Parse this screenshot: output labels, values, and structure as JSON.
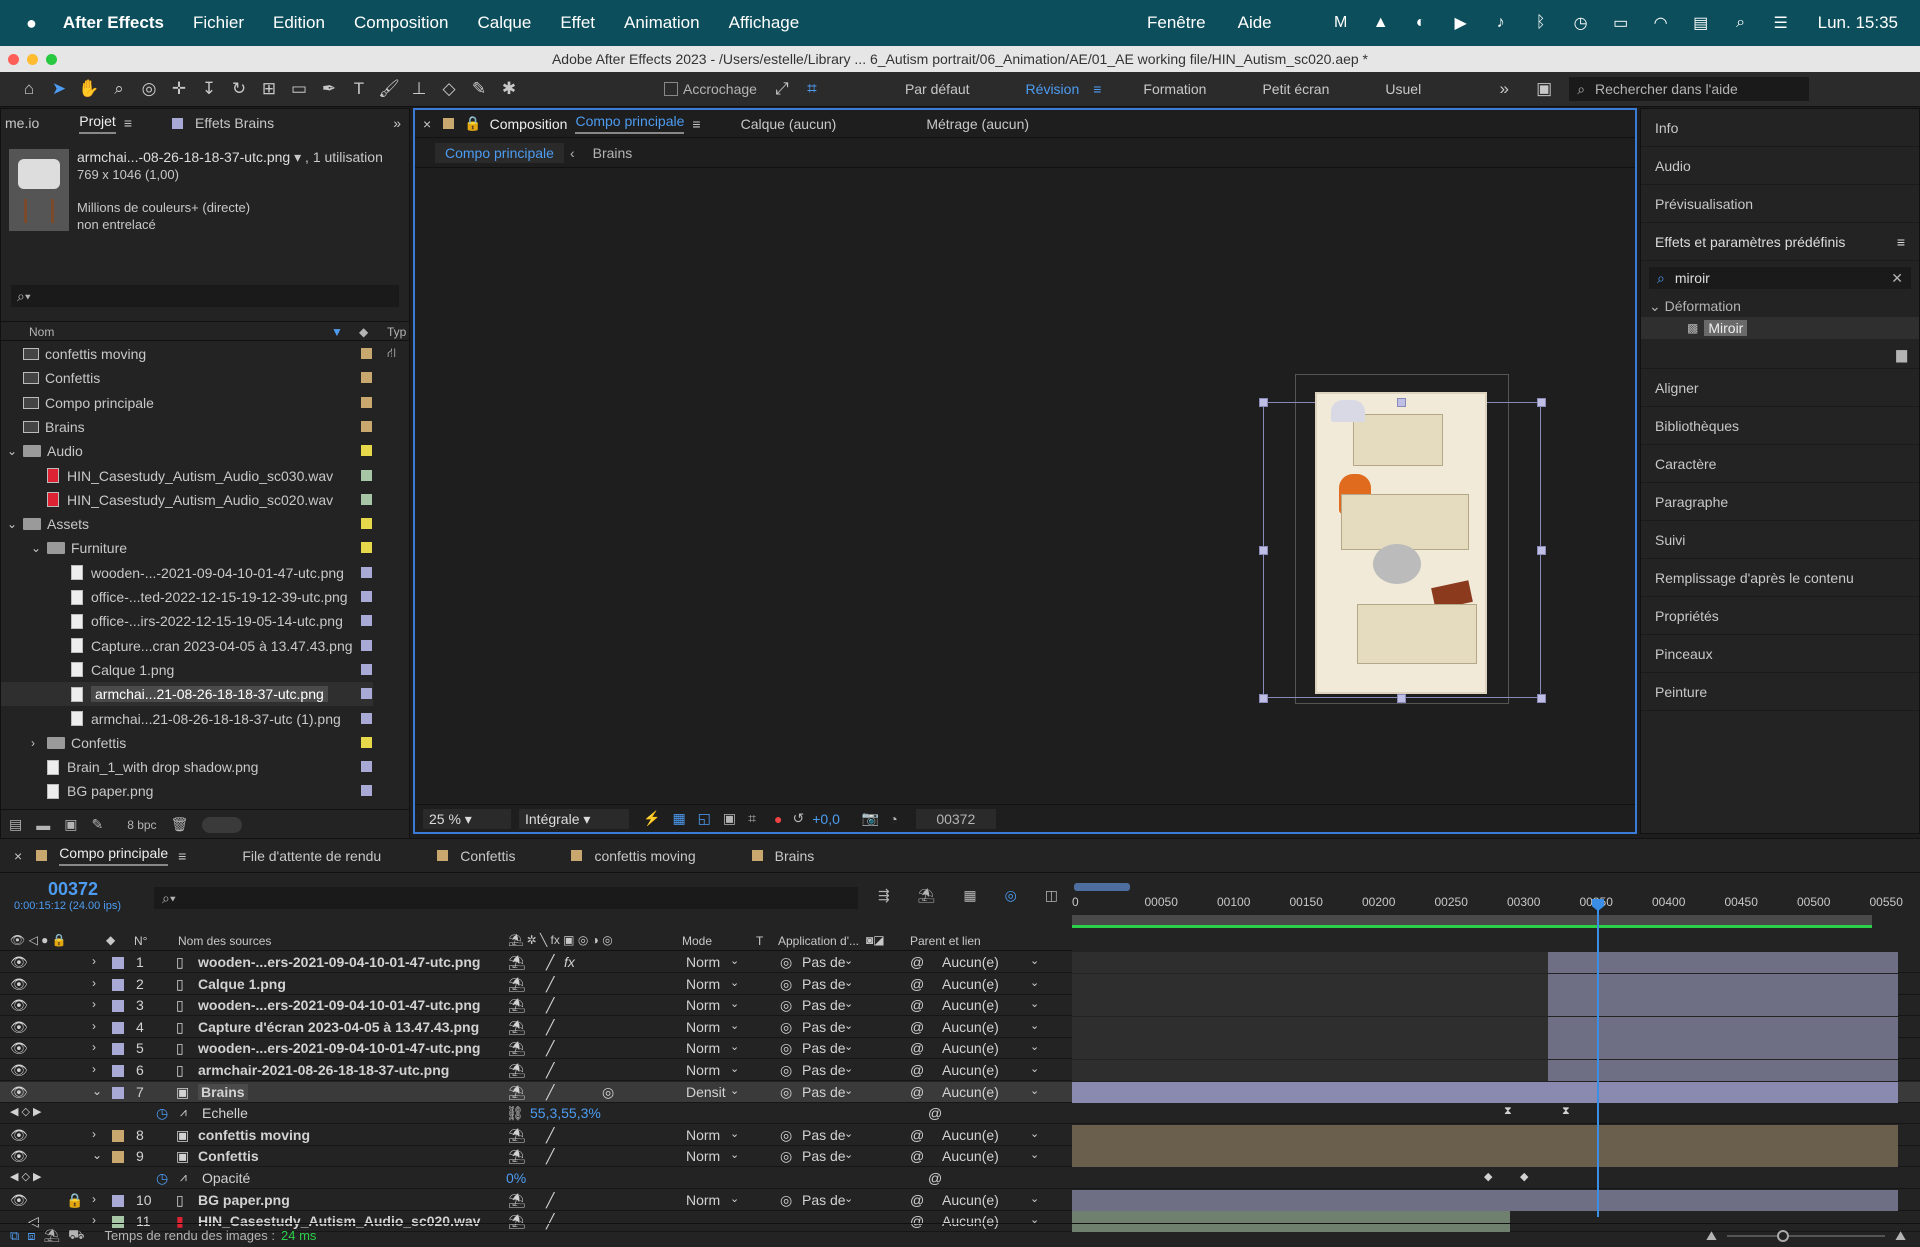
{
  "menubar": {
    "app_name": "After Effects",
    "items": [
      "Fichier",
      "Edition",
      "Composition",
      "Calque",
      "Effet",
      "Animation",
      "Affichage"
    ],
    "right_items": [
      "Fenêtre",
      "Aide"
    ],
    "clock": "Lun. 15:35"
  },
  "window": {
    "title": "Adobe After Effects 2023 - /Users/estelle/Library ... 6_Autism portrait/06_Animation/AE/01_AE working file/HIN_Autism_sc020.aep *"
  },
  "toolbar": {
    "snapping_label": "Accrochage",
    "workspaces": [
      "Par défaut",
      "Révision",
      "Formation",
      "Petit écran",
      "Usuel"
    ],
    "active_workspace": "Révision",
    "help_search_placeholder": "Rechercher dans l'aide"
  },
  "project_panel": {
    "tabs": [
      "me.io",
      "Projet",
      "Effets Brains"
    ],
    "preview": {
      "name": "armchai...-08-26-18-18-37-utc.png",
      "usage": ", 1 utilisation",
      "dimensions": "769 x 1046 (1,00)",
      "color": "Millions de couleurs+ (directe)",
      "scan": "non entrelacé"
    },
    "col_name": "Nom",
    "col_type": "Typ",
    "items": [
      {
        "name": "confettis moving",
        "kind": "comp",
        "indent": 0,
        "label": "#c9a86f"
      },
      {
        "name": "Confettis",
        "kind": "comp",
        "indent": 0,
        "label": "#c9a86f"
      },
      {
        "name": "Compo principale",
        "kind": "comp",
        "indent": 0,
        "label": "#c9a86f"
      },
      {
        "name": "Brains",
        "kind": "comp",
        "indent": 0,
        "label": "#c9a86f"
      },
      {
        "name": "Audio",
        "kind": "folder",
        "indent": 0,
        "open": true,
        "label": "#e6d84a"
      },
      {
        "name": "HIN_Casestudy_Autism_Audio_sc030.wav",
        "kind": "audio",
        "indent": 1,
        "label": "#a6c6a6"
      },
      {
        "name": "HIN_Casestudy_Autism_Audio_sc020.wav",
        "kind": "audio",
        "indent": 1,
        "label": "#a6c6a6"
      },
      {
        "name": "Assets",
        "kind": "folder",
        "indent": 0,
        "open": true,
        "label": "#e6d84a"
      },
      {
        "name": "Furniture",
        "kind": "folder",
        "indent": 1,
        "open": true,
        "label": "#e6d84a"
      },
      {
        "name": "wooden-...-2021-09-04-10-01-47-utc.png",
        "kind": "file",
        "indent": 2,
        "label": "#a9a9d6"
      },
      {
        "name": "office-...ted-2022-12-15-19-12-39-utc.png",
        "kind": "file",
        "indent": 2,
        "label": "#a9a9d6"
      },
      {
        "name": "office-...irs-2022-12-15-19-05-14-utc.png",
        "kind": "file",
        "indent": 2,
        "label": "#a9a9d6"
      },
      {
        "name": "Capture...cran 2023-04-05 à 13.47.43.png",
        "kind": "file",
        "indent": 2,
        "label": "#a9a9d6"
      },
      {
        "name": "Calque 1.png",
        "kind": "file",
        "indent": 2,
        "label": "#a9a9d6"
      },
      {
        "name": "armchai...21-08-26-18-18-37-utc.png",
        "kind": "file",
        "indent": 2,
        "label": "#a9a9d6",
        "selected": true
      },
      {
        "name": "armchai...21-08-26-18-18-37-utc (1).png",
        "kind": "file",
        "indent": 2,
        "label": "#a9a9d6"
      },
      {
        "name": "Confettis",
        "kind": "folder",
        "indent": 1,
        "open": false,
        "label": "#e6d84a"
      },
      {
        "name": "Brain_1_with drop shadow.png",
        "kind": "file",
        "indent": 1,
        "label": "#a9a9d6"
      },
      {
        "name": "BG paper.png",
        "kind": "file",
        "indent": 1,
        "label": "#a9a9d6"
      }
    ],
    "bpc": "8 bpc"
  },
  "comp_panel": {
    "tab_prefix": "Composition",
    "tab_name": "Compo principale",
    "other_tabs": [
      "Calque (aucun)",
      "Métrage (aucun)"
    ],
    "breadcrumb": [
      "Compo principale",
      "Brains"
    ],
    "zoom": "25 %",
    "resolution": "Intégrale",
    "exposure": "+0,0",
    "timecode": "00372"
  },
  "right_panel": {
    "items_top": [
      "Info",
      "Audio",
      "Prévisualisation"
    ],
    "effects_title": "Effets et paramètres prédéfinis",
    "search_value": "miroir",
    "category": "Déformation",
    "effect": "Miroir",
    "items_bottom": [
      "Aligner",
      "Bibliothèques",
      "Caractère",
      "Paragraphe",
      "Suivi",
      "Remplissage d'après le contenu",
      "Propriétés",
      "Pinceaux",
      "Peinture"
    ]
  },
  "timeline": {
    "tabs": [
      "Compo principale",
      "File d'attente de rendu",
      "Confettis",
      "confettis moving",
      "Brains"
    ],
    "timecode": "00372",
    "timecode_sub": "0:00:15:12 (24.00 ips)",
    "ruler": [
      "0",
      "00050",
      "00100",
      "00150",
      "00200",
      "00250",
      "00300",
      "00350",
      "00400",
      "00450",
      "00500",
      "00550"
    ],
    "headers": {
      "num": "N°",
      "source": "Nom des sources",
      "mode": "Mode",
      "t": "T",
      "matte": "Application d'...",
      "parent": "Parent et lien"
    },
    "layers": [
      {
        "num": "1",
        "name": "wooden-...ers-2021-09-04-10-01-47-utc.png",
        "type": "file",
        "label": "#a9a9d6",
        "mode": "Norm",
        "matte": "Pas de",
        "parent": "Aucun(e)",
        "fx": true,
        "bar": "late"
      },
      {
        "num": "2",
        "name": "Calque 1.png",
        "type": "file",
        "label": "#a9a9d6",
        "mode": "Norm",
        "matte": "Pas de",
        "parent": "Aucun(e)",
        "bar": "late"
      },
      {
        "num": "3",
        "name": "wooden-...ers-2021-09-04-10-01-47-utc.png",
        "type": "file",
        "label": "#a9a9d6",
        "mode": "Norm",
        "matte": "Pas de",
        "parent": "Aucun(e)",
        "bar": "late"
      },
      {
        "num": "4",
        "name": "Capture d'écran 2023-04-05 à 13.47.43.png",
        "type": "file",
        "label": "#a9a9d6",
        "mode": "Norm",
        "matte": "Pas de",
        "parent": "Aucun(e)",
        "bar": "late"
      },
      {
        "num": "5",
        "name": "wooden-...ers-2021-09-04-10-01-47-utc.png",
        "type": "file",
        "label": "#a9a9d6",
        "mode": "Norm",
        "matte": "Pas de",
        "parent": "Aucun(e)",
        "bar": "late"
      },
      {
        "num": "6",
        "name": "armchair-2021-08-26-18-18-37-utc.png",
        "type": "file",
        "label": "#a9a9d6",
        "mode": "Norm",
        "matte": "Pas de",
        "parent": "Aucun(e)",
        "bar": "late"
      },
      {
        "num": "7",
        "name": "Brains",
        "type": "comp",
        "label": "#a9a9d6",
        "mode": "Densit",
        "matte": "Pas de",
        "parent": "Aucun(e)",
        "selected": true,
        "bar": "full-purple"
      },
      {
        "prop": true,
        "name": "Echelle",
        "value": "55,3,55,3%"
      },
      {
        "num": "8",
        "name": "confettis moving",
        "type": "comp",
        "label": "#c9a86f",
        "mode": "Norm",
        "matte": "Pas de",
        "parent": "Aucun(e)",
        "bar": "full-tan"
      },
      {
        "num": "9",
        "name": "Confettis",
        "type": "comp",
        "label": "#c9a86f",
        "mode": "Norm",
        "matte": "Pas de",
        "parent": "Aucun(e)",
        "bar": "full-tan"
      },
      {
        "prop": true,
        "name": "Opacité",
        "value": "0%"
      },
      {
        "num": "10",
        "name": "BG paper.png",
        "type": "file",
        "label": "#a9a9d6",
        "mode": "Norm",
        "matte": "Pas de",
        "parent": "Aucun(e)",
        "locked": true,
        "bar": "full-gray"
      },
      {
        "num": "11",
        "name": "HIN_Casestudy_Autism_Audio_sc020.wav",
        "type": "audio",
        "label": "#a6c6a6",
        "mode": "",
        "matte": "",
        "parent": "Aucun(e)",
        "bar": "audio"
      }
    ],
    "render_time_label": "Temps de rendu des images :",
    "render_time_value": "24 ms"
  }
}
